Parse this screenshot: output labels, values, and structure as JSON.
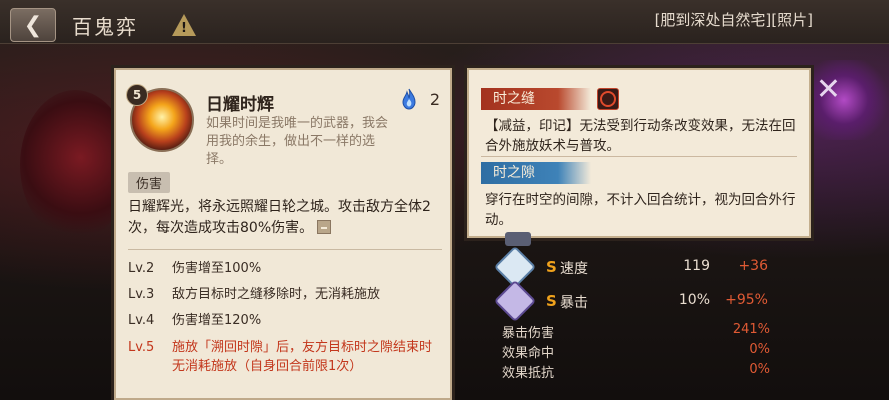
{
  "header": {
    "title": "百鬼弈",
    "breadcrumb": "[肥到深处自然宅][照片]"
  },
  "skill": {
    "level": "5",
    "name": "日耀时辉",
    "flavor": "如果时间是我唯一的武器，我会用我的余生，做出不一样的选择。",
    "cost": "2",
    "tag": "伤害",
    "description": "日耀辉光，将永远照耀日轮之城。攻击敌方全体2次，每次造成攻击80%伤害。",
    "levels": [
      {
        "lv": "Lv.2",
        "text": "伤害增至100%"
      },
      {
        "lv": "Lv.3",
        "text": "敌方目标时之缝移除时，无消耗施放"
      },
      {
        "lv": "Lv.4",
        "text": "伤害增至120%"
      },
      {
        "lv": "Lv.5",
        "text": "施放「溯回时隙」后，友方目标时之隙结束时无消耗施放（自身回合前限1次）"
      }
    ]
  },
  "tooltip": {
    "effect1": {
      "title": "时之缝",
      "text": "【减益，印记】无法受到行动条改变效果，无法在回合外施放妖术与普攻。"
    },
    "effect2": {
      "title": "时之隙",
      "text": "穿行在时空的间隙，不计入回合统计，视为回合外行动。"
    }
  },
  "stats": [
    {
      "icon": "speed-icon",
      "label": "速度",
      "value": "119",
      "bonus": "+36"
    },
    {
      "icon": "crit-icon",
      "label": "暴击",
      "value": "10%",
      "bonus": "+95%"
    }
  ],
  "sub_stats": [
    {
      "label": "暴击伤害",
      "value": "241%"
    },
    {
      "label": "效果命中",
      "value": "0%"
    },
    {
      "label": "效果抵抗",
      "value": "0%"
    }
  ],
  "colors": {
    "card_bg": "#f1e8d7",
    "accent_red": "#c3371c",
    "accent_blue": "#3e82b8",
    "bonus_orange": "#e05a34"
  }
}
